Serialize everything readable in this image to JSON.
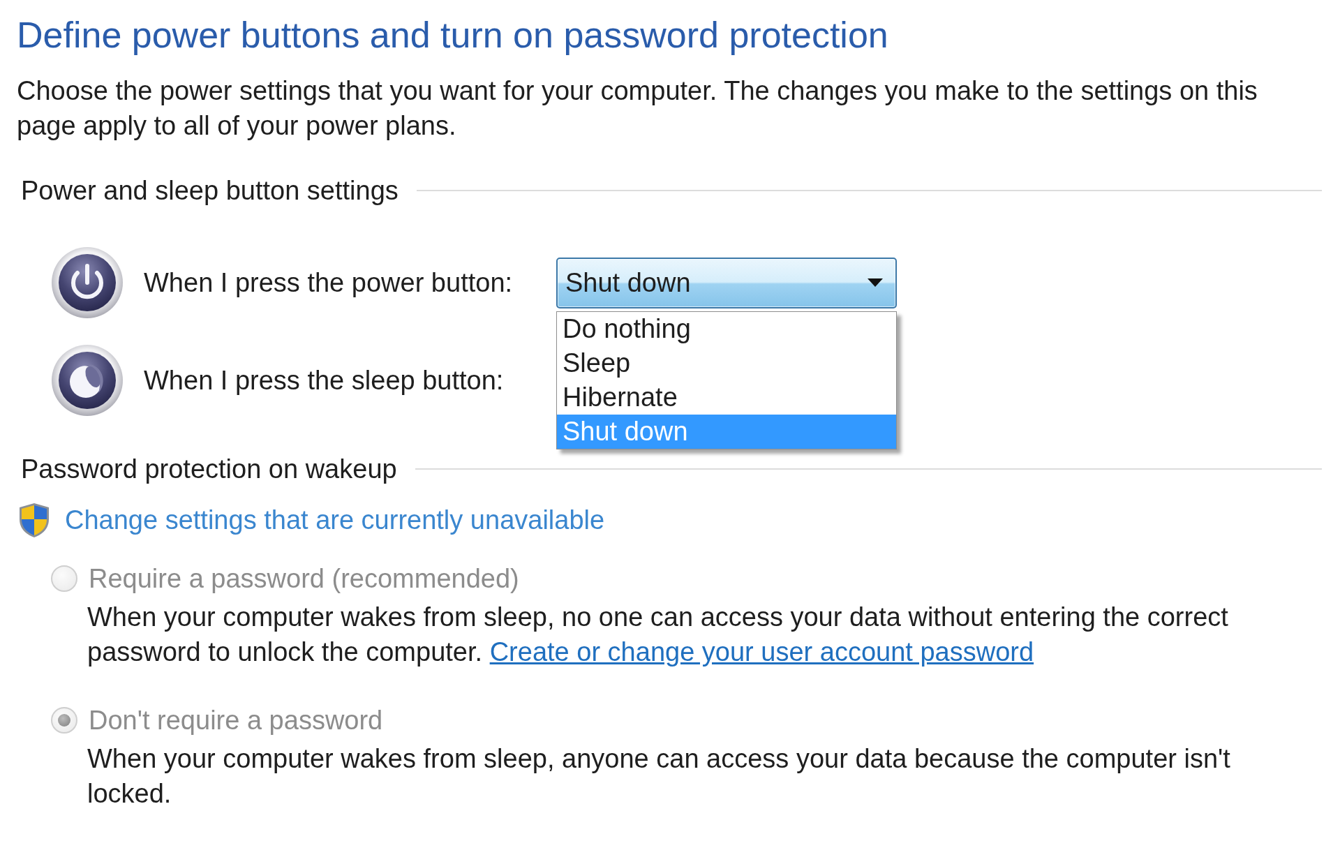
{
  "title": "Define power buttons and turn on password protection",
  "intro": "Choose the power settings that you want for your computer. The changes you make to the settings on this page apply to all of your power plans.",
  "button_settings": {
    "heading": "Power and sleep button settings",
    "rows": [
      {
        "kind": "power",
        "label": "When I press the power button:",
        "dropdown": {
          "value": "Shut down",
          "expanded": true,
          "options": [
            {
              "label": "Do nothing",
              "selected": false
            },
            {
              "label": "Sleep",
              "selected": false
            },
            {
              "label": "Hibernate",
              "selected": false
            },
            {
              "label": "Shut down",
              "selected": true
            }
          ]
        }
      },
      {
        "kind": "sleep",
        "label": "When I press the sleep button:"
      }
    ]
  },
  "password_protection": {
    "heading": "Password protection on wakeup",
    "admin_link": "Change settings that are currently unavailable",
    "options": [
      {
        "label": "Require a password (recommended)",
        "checked": false,
        "disabled": true,
        "description": "When your computer wakes from sleep, no one can access your data without entering the correct password to unlock the computer.",
        "link": "Create or change your user account password"
      },
      {
        "label": "Don't require a password",
        "checked": true,
        "disabled": true,
        "description": "When your computer wakes from sleep, anyone can access your data because the computer isn't locked."
      }
    ]
  }
}
